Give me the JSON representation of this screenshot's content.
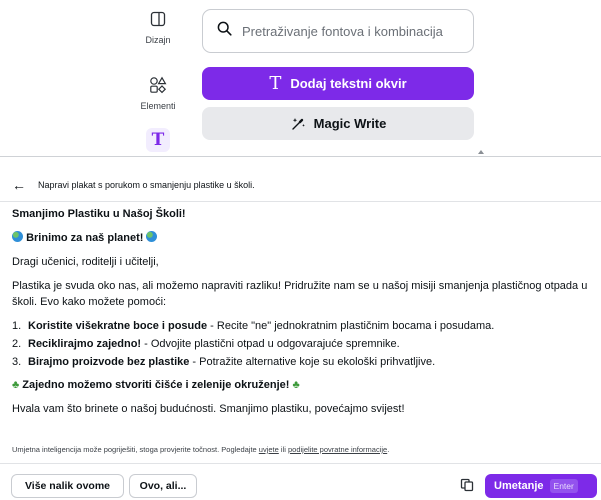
{
  "sidebar": {
    "design_label": "Dizajn",
    "elements_label": "Elementi"
  },
  "search": {
    "placeholder": "Pretraživanje fontova i kombinacija"
  },
  "buttons": {
    "add_text_box": "Dodaj tekstni okvir",
    "magic_write": "Magic Write"
  },
  "assistant": {
    "prompt": "Napravi plakat s porukom o smanjenju plastike u školi.",
    "heading": "Smanjimo Plastiku u Našoj Školi!",
    "subheading": "Brinimo za naš planet!",
    "greeting": "Dragi učenici, roditelji i učitelji,",
    "intro": "Plastika je svuda oko nas, ali možemo napraviti razliku! Pridružite nam se u našoj misiji smanjenja plastičnog otpada u školi. Evo kako možete pomoći:",
    "tips": [
      {
        "num": "1.",
        "bold": "Koristite višekratne boce i posude",
        "rest": " - Recite \"ne\" jednokratnim plastičnim bocama i posudama."
      },
      {
        "num": "2.",
        "bold": "Reciklirajmo zajedno!",
        "rest": " - Odvojite plastični otpad u odgovarajuće spremnike."
      },
      {
        "num": "3.",
        "bold": "Birajmo proizvode bez plastike",
        "rest": " - Potražite alternative koje su ekološki prihvatljive."
      }
    ],
    "slogan": "Zajedno možemo stvoriti čišće i zelenije okruženje!",
    "closing": "Hvala vam što brinete o našoj budućnosti. Smanjimo plastiku, povećajmo svijest!",
    "disclaimer_text": "Umjetna inteligencija može pogriješiti, stoga provjerite točnost. Pogledajte ",
    "disclaimer_link1": "uvjete",
    "disclaimer_mid": " ili ",
    "disclaimer_link2": "podijelite povratne informacije",
    "disclaimer_end": "."
  },
  "footer": {
    "more_like_this": "Više nalik ovome",
    "yes_but": "Ovo, ali...",
    "insert": "Umetanje",
    "enter_hint": "Enter"
  },
  "colors": {
    "accent": "#7d2ae8",
    "secondary_button": "#e8e9ec",
    "text": "#0d1216"
  }
}
